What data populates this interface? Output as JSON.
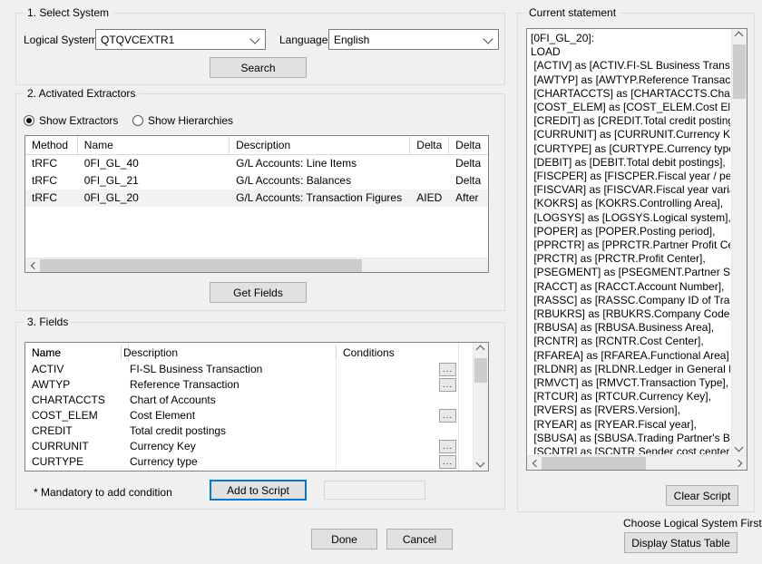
{
  "select_system": {
    "title": "1. Select System",
    "logical_system_label": "Logical System:",
    "logical_system_value": "QTQVCEXTR1",
    "language_label": "Language:",
    "language_value": "English",
    "search_button": "Search"
  },
  "activated_extractors": {
    "title": "2. Activated Extractors",
    "radio_extractors": "Show Extractors",
    "radio_hierarchies": "Show Hierarchies",
    "selected_radio": "Show Extractors",
    "columns": [
      "Method",
      "Name",
      "Description",
      "Delta",
      "Delta"
    ],
    "rows": [
      {
        "method": "tRFC",
        "name": "0FI_GL_40",
        "description": "G/L Accounts: Line Items",
        "delta1": "",
        "delta2": "Delta",
        "selected": false
      },
      {
        "method": "tRFC",
        "name": "0FI_GL_21",
        "description": "G/L Accounts: Balances",
        "delta1": "",
        "delta2": "Delta",
        "selected": false
      },
      {
        "method": "tRFC",
        "name": "0FI_GL_20",
        "description": "G/L Accounts: Transaction Figures",
        "delta1": "AIED",
        "delta2": "After",
        "selected": true
      }
    ],
    "get_fields_button": "Get Fields"
  },
  "fields": {
    "title": "3. Fields",
    "columns": [
      "Name",
      "Description",
      "Conditions"
    ],
    "rows": [
      {
        "name": "ACTIV",
        "description": "FI-SL Business Transaction",
        "condition": "",
        "has_ellipsis": true
      },
      {
        "name": "AWTYP",
        "description": "Reference Transaction",
        "condition": "",
        "has_ellipsis": true
      },
      {
        "name": "CHARTACCTS",
        "description": "Chart of Accounts",
        "condition": "",
        "has_ellipsis": false
      },
      {
        "name": "COST_ELEM",
        "description": "Cost Element",
        "condition": "",
        "has_ellipsis": true
      },
      {
        "name": "CREDIT",
        "description": "Total credit postings",
        "condition": "",
        "has_ellipsis": false
      },
      {
        "name": "CURRUNIT",
        "description": "Currency Key",
        "condition": "",
        "has_ellipsis": true
      },
      {
        "name": "CURTYPE",
        "description": "Currency type",
        "condition": "",
        "has_ellipsis": true
      }
    ],
    "ellipsis_label": "...",
    "mandatory_note": "* Mandatory to add condition",
    "add_to_script_button": "Add to Script",
    "side_input_value": ""
  },
  "current_statement": {
    "title": "Current statement",
    "script": "[0FI_GL_20]:\nLOAD\n [ACTIV] as [ACTIV.FI-SL Business Transac\n [AWTYP] as [AWTYP.Reference Transacti\n [CHARTACCTS] as [CHARTACCTS.Chart o\n [COST_ELEM] as [COST_ELEM.Cost Eleme\n [CREDIT] as [CREDIT.Total credit postings\n [CURRUNIT] as [CURRUNIT.Currency Key\n [CURTYPE] as [CURTYPE.Currency type],\n [DEBIT] as [DEBIT.Total debit postings],\n [FISCPER] as [FISCPER.Fiscal year / perio\n [FISCVAR] as [FISCVAR.Fiscal year varian\n [KOKRS] as [KOKRS.Controlling Area],\n [LOGSYS] as [LOGSYS.Logical system],\n [POPER] as [POPER.Posting period],\n [PPRCTR] as [PPRCTR.Partner Profit Cent\n [PRCTR] as [PRCTR.Profit Center],\n [PSEGMENT] as [PSEGMENT.Partner Segm\n [RACCT] as [RACCT.Account Number],\n [RASSC] as [RASSC.Company ID of Tradir\n [RBUKRS] as [RBUKRS.Company Code],\n [RBUSA] as [RBUSA.Business Area],\n [RCNTR] as [RCNTR.Cost Center],\n [RFAREA] as [RFAREA.Functional Area],\n [RLDNR] as [RLDNR.Ledger in General Lec\n [RMVCT] as [RMVCT.Transaction Type],\n [RTCUR] as [RTCUR.Currency Key],\n [RVERS] as [RVERS.Version],\n [RYEAR] as [RYEAR.Fiscal year],\n [SBUSA] as [SBUSA.Trading Partner's Busi\n [SCNTR] as [SCNTR.Sender cost center],\n [SEGMENT] as [SEGMENT.Segment for Seg\n [SFAREA] as [SFAREA.Partner Functional\n [TURNOVER] as [TURNOVER.Sales of the \n [UPMOD] as [UPMOD.BW Delta Process: R\n [VALUETYPE] as [VALUETYPE.Value type f",
    "clear_script_button": "Clear Script",
    "status_hint": "Choose Logical System First",
    "display_status_table_button": "Display Status Table"
  },
  "footer": {
    "done_button": "Done",
    "cancel_button": "Cancel"
  },
  "colors": {
    "window_background": "#f0f0f0",
    "field_background": "#ffffff",
    "accent": "#0078d7",
    "selected_row": "#f2f2f2"
  }
}
